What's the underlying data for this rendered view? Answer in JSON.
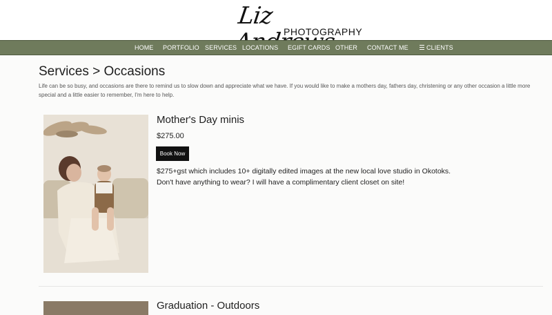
{
  "brand": {
    "script": "Liz Andrews",
    "subtitle": "PHOTOGRAPHY"
  },
  "nav": {
    "items": [
      "HOME",
      "PORTFOLIO",
      "SERVICES",
      "LOCATIONS",
      "EGIFT CARDS",
      "OTHER",
      "CONTACT ME"
    ],
    "clients_label": "CLIENTS",
    "clients_icon": "menu-icon"
  },
  "page": {
    "title": "Services > Occasions",
    "intro": "Life can be so busy, and occasions are there to remind us to slow down and appreciate what we have. If you would like to make a mothers day, fathers day, christening or any other occasion a little more special and a little easier to remember, I'm here to help."
  },
  "services": [
    {
      "title": "Mother's Day minis",
      "price": "$275.00",
      "button": "Book Now",
      "desc_line1": "$275+gst which includes 10+ digitally edited images at the new local love studio in Okotoks.",
      "desc_line2": "Don't have anything to wear? I will have a complimentary client closet on site!"
    },
    {
      "title": "Graduation - Outdoors"
    }
  ],
  "colors": {
    "nav_bg": "#6f7b5c",
    "button_bg": "#111111",
    "page_bg": "#fbfbfa"
  }
}
